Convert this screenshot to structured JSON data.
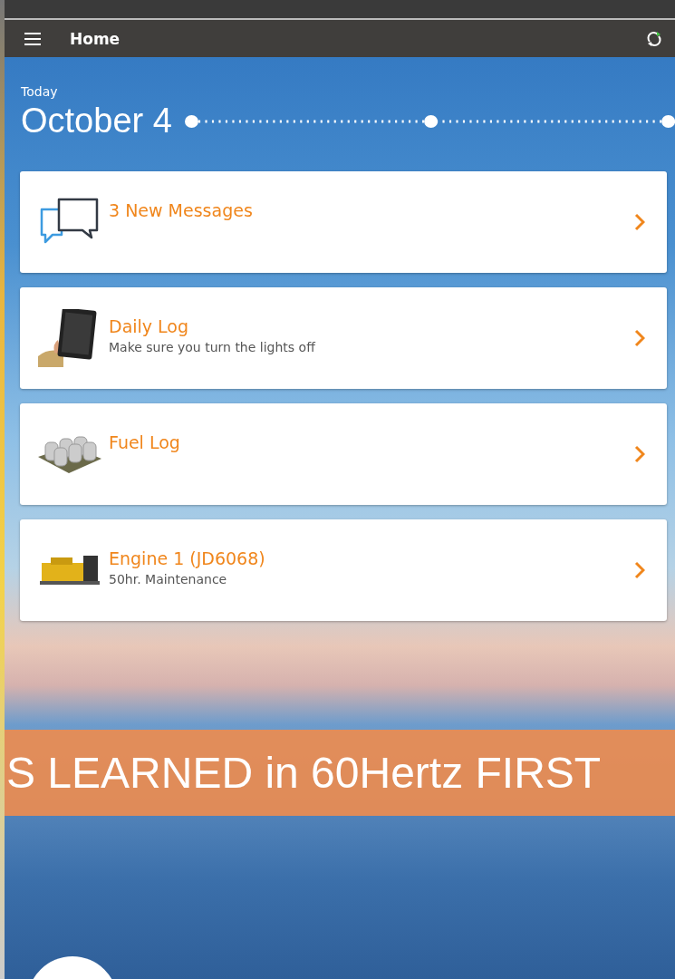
{
  "app_bar": {
    "title": "Home"
  },
  "date_header": {
    "label": "Today",
    "date": "October 4"
  },
  "cards": [
    {
      "title": "3 New Messages"
    },
    {
      "title": "Daily Log",
      "subtitle": "Make sure you turn the lights off"
    },
    {
      "title": "Fuel Log"
    },
    {
      "title": "Engine 1 (JD6068)",
      "subtitle": "50hr. Maintenance"
    }
  ],
  "banner": {
    "text": "S LEARNED in 60Hertz FIRST"
  }
}
